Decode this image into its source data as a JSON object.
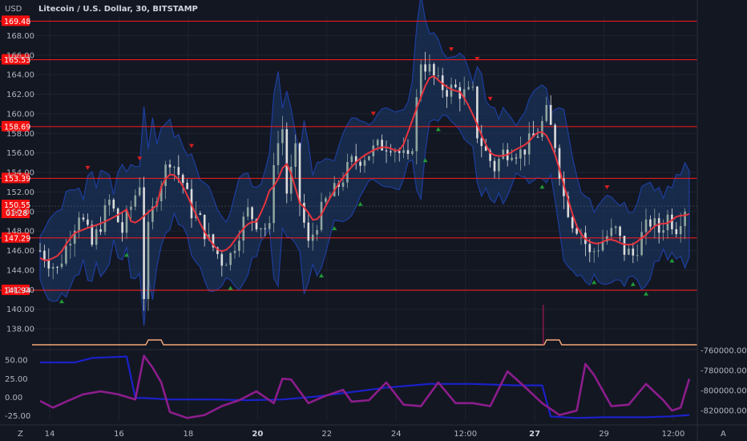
{
  "chart_data": {
    "type": "candlestick",
    "title": "Litecoin / U.S. Dollar, 30, BITSTAMP",
    "currency_label": "USD",
    "price_axis": {
      "ylim": [
        138.0,
        170.0
      ],
      "ticks": [
        "168.00",
        "166.00",
        "164.00",
        "162.00",
        "160.00",
        "158.00",
        "156.00",
        "154.00",
        "152.00",
        "150.00",
        "148.00",
        "146.00",
        "144.00",
        "142.00",
        "140.00",
        "138.00"
      ]
    },
    "x_ticks": [
      "14",
      "16",
      "18",
      "20",
      "22",
      "24",
      "12:00",
      "27",
      "29",
      "12:00"
    ],
    "support_resistance": [
      {
        "label": "169.48",
        "value": 169.48
      },
      {
        "label": "165.53",
        "value": 165.53
      },
      {
        "label": "158.69",
        "value": 158.69
      },
      {
        "label": "153.39",
        "value": 153.39
      },
      {
        "label": "147.29",
        "value": 147.29
      },
      {
        "label": "141.94",
        "value": 141.94
      }
    ],
    "last_price": {
      "label": "150.55",
      "countdown": "01:28",
      "value": 150.55
    },
    "price_path": [
      [
        0,
        146.0
      ],
      [
        4,
        144.0
      ],
      [
        9,
        150.0
      ],
      [
        12,
        146.5
      ],
      [
        16,
        151.0
      ],
      [
        19,
        148.0
      ],
      [
        23,
        153.0
      ],
      [
        24,
        141.5
      ],
      [
        25,
        148.0
      ],
      [
        27,
        152.0
      ],
      [
        30,
        155.5
      ],
      [
        33,
        153.0
      ],
      [
        35,
        150.0
      ],
      [
        37,
        149.0
      ],
      [
        39,
        147.0
      ],
      [
        42,
        145.0
      ],
      [
        44,
        145.5
      ],
      [
        46,
        148.0
      ],
      [
        48,
        150.0
      ],
      [
        50,
        149.0
      ],
      [
        53,
        148.0
      ],
      [
        54,
        155.5
      ],
      [
        56,
        158.5
      ],
      [
        57,
        152.0
      ],
      [
        59,
        156.0
      ],
      [
        60,
        151.0
      ],
      [
        62,
        146.5
      ],
      [
        64,
        149.0
      ],
      [
        66,
        151.0
      ],
      [
        68,
        152.0
      ],
      [
        70,
        153.5
      ],
      [
        72,
        155.0
      ],
      [
        74,
        155.5
      ],
      [
        76,
        156.0
      ],
      [
        79,
        156.8
      ],
      [
        81,
        157.0
      ],
      [
        83,
        156.0
      ],
      [
        85,
        155.0
      ],
      [
        86,
        157.0
      ],
      [
        88,
        165.5
      ],
      [
        90,
        164.5
      ],
      [
        92,
        163.0
      ],
      [
        94,
        162.5
      ],
      [
        96,
        162.5
      ],
      [
        98,
        162.0
      ],
      [
        100,
        162.0
      ],
      [
        101,
        158.0
      ],
      [
        103,
        156.0
      ],
      [
        105,
        154.5
      ],
      [
        107,
        156.0
      ],
      [
        109,
        156.5
      ],
      [
        111,
        156.0
      ],
      [
        113,
        157.0
      ],
      [
        115,
        158.0
      ],
      [
        117,
        160.0
      ],
      [
        119,
        157.0
      ],
      [
        121,
        151.5
      ],
      [
        123,
        149.0
      ],
      [
        125,
        148.0
      ],
      [
        127,
        145.5
      ],
      [
        129,
        146.5
      ],
      [
        131,
        147.5
      ],
      [
        133,
        148.0
      ],
      [
        135,
        146.0
      ],
      [
        137,
        145.5
      ],
      [
        139,
        147.5
      ],
      [
        141,
        149.0
      ],
      [
        143,
        148.0
      ],
      [
        145,
        149.5
      ],
      [
        147,
        148.5
      ],
      [
        149,
        150.5
      ]
    ],
    "candles_shown": 150,
    "volume": {
      "spikes_at": [
        25,
        117
      ]
    },
    "oscillator": {
      "ylim": [
        -32,
        60
      ],
      "ticks": [
        "50.00",
        "25.00",
        "0.00",
        "-25.00"
      ],
      "right_ticks": [
        "-760000.00",
        "-780000.00",
        "-800000.00",
        "-820000.00"
      ],
      "blue_line": {
        "name": "",
        "color": "#1a21c9",
        "points": [
          [
            0,
            47
          ],
          [
            8,
            47
          ],
          [
            12,
            53
          ],
          [
            20,
            55
          ],
          [
            22,
            -1
          ],
          [
            24,
            -1
          ],
          [
            30,
            -3
          ],
          [
            40,
            -3
          ],
          [
            48,
            -4
          ],
          [
            56,
            -3
          ],
          [
            64,
            1
          ],
          [
            72,
            7
          ],
          [
            80,
            13
          ],
          [
            88,
            17
          ],
          [
            90,
            18
          ],
          [
            100,
            18
          ],
          [
            110,
            16
          ],
          [
            116,
            16
          ],
          [
            118,
            -26
          ],
          [
            124,
            -28
          ],
          [
            130,
            -27
          ],
          [
            140,
            -27
          ],
          [
            145,
            -26
          ],
          [
            150,
            -24
          ]
        ]
      },
      "purple_line": {
        "name": "",
        "color": "#8c1d8c",
        "points": [
          [
            0,
            -5
          ],
          [
            3,
            -14
          ],
          [
            6,
            -6
          ],
          [
            10,
            4
          ],
          [
            14,
            8
          ],
          [
            18,
            4
          ],
          [
            22,
            -3
          ],
          [
            24,
            56
          ],
          [
            26,
            40
          ],
          [
            28,
            20
          ],
          [
            30,
            -20
          ],
          [
            34,
            -28
          ],
          [
            38,
            -24
          ],
          [
            42,
            -12
          ],
          [
            46,
            -4
          ],
          [
            50,
            8
          ],
          [
            54,
            -8
          ],
          [
            56,
            25
          ],
          [
            58,
            24
          ],
          [
            62,
            -8
          ],
          [
            66,
            2
          ],
          [
            70,
            10
          ],
          [
            72,
            -6
          ],
          [
            76,
            -4
          ],
          [
            80,
            20
          ],
          [
            84,
            -10
          ],
          [
            88,
            -12
          ],
          [
            92,
            20
          ],
          [
            96,
            -8
          ],
          [
            100,
            -8
          ],
          [
            104,
            -12
          ],
          [
            108,
            35
          ],
          [
            112,
            14
          ],
          [
            116,
            -8
          ],
          [
            120,
            -24
          ],
          [
            124,
            -18
          ],
          [
            126,
            45
          ],
          [
            128,
            30
          ],
          [
            132,
            -12
          ],
          [
            136,
            -10
          ],
          [
            140,
            18
          ],
          [
            144,
            -4
          ],
          [
            146,
            -18
          ],
          [
            148,
            -14
          ],
          [
            150,
            25
          ]
        ]
      }
    },
    "colors": {
      "background": "#131722",
      "grid": "#1f2330",
      "sr_line": "#ff1a1a",
      "candle_up": "#8fa49e",
      "candle_down": "#dcdcdc",
      "ma_line": "#e8343e",
      "band_fill": "#1b3a6b",
      "band_edge": "#1d3e9e",
      "marker_up": "#1e9a38",
      "marker_down": "#d81f1f",
      "volume_line": "#f4a97a"
    },
    "ui": {
      "left_bottom": "Z",
      "right_bottom": "A",
      "axis_sep": "|"
    }
  }
}
